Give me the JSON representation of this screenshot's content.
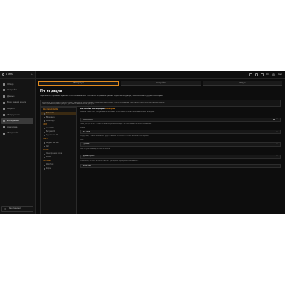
{
  "brand": {
    "name": "A Оrbs"
  },
  "sidebar": {
    "items": [
      {
        "label": "Обзор"
      },
      {
        "label": "Настройки"
      },
      {
        "label": "Данные"
      },
      {
        "label": "Базы знаний агента"
      },
      {
        "label": "Модели"
      },
      {
        "label": "Инструменты"
      },
      {
        "label": "Интеграции"
      },
      {
        "label": "Аналитика"
      },
      {
        "label": "Интерфейс"
      }
    ],
    "footer": {
      "label": "Ваш Кабинет"
    }
  },
  "topbar": {
    "lang": "RU",
    "user": "User"
  },
  "steps": [
    {
      "label": "Интеграции"
    },
    {
      "label": "Настройки"
    },
    {
      "label": "Запуск"
    }
  ],
  "page": {
    "title": "Интеграции",
    "description": "Подключите сторонние сервисы, чтобы ваш агент мог получать и отправлять данные через мессенджеры, CRM-системы и другие платформы.",
    "info": [
      "Выберите интеграцию в списке слева и заполните необходимые параметры подключения. После сохранения агент начнёт работать в выбранном канале.",
      "Некоторые интеграции требуют дополнительных ключей доступа."
    ]
  },
  "integrations": {
    "groups": [
      {
        "title": "Мессенджеры",
        "items": [
          "Телеграм",
          "ВКонтакте",
          "WhatsApp"
        ]
      },
      {
        "title": "CRM",
        "items": [
          "amoCRM",
          "Битрикс24",
          "Сделки по API"
        ]
      },
      {
        "title": "Сайт",
        "items": [
          "Виджет на сайт",
          "API"
        ]
      },
      {
        "title": "Почта",
        "items": [
          "Электронная почта",
          "SMTP"
        ]
      },
      {
        "title": "Прочее",
        "items": [
          "Webhook",
          "Zapier"
        ]
      }
    ],
    "selected": "Телеграм"
  },
  "detail": {
    "title_prefix": "Настройки интеграции",
    "title_accent": "Телеграм",
    "subtitle": "Укажите токен бота, полученный в BotFather, чтобы агент отвечал пользователям в Телеграм.",
    "sections": [
      {
        "label": "Токен",
        "value": "••••••••••••••••",
        "hint": "Токен доступа к боту. Хранится в зашифрованном виде и не отображается после сохранения."
      },
      {
        "label": "Режим",
        "value": "Все чаты",
        "hint": "Определяет, в каких чатах агент будет отвечать: во всех или только в личных сообщениях."
      },
      {
        "label": "Язык",
        "value": "Русский",
        "hint": "Язык по умолчанию для ответов агента."
      },
      {
        "label": "Приветствие",
        "value": "Здравствуйте!",
        "hint": "Сообщение, которое агент отправляет при первом обращении пользователя."
      },
      {
        "label": "Уведомления",
        "value": "Включены",
        "hint": ""
      }
    ]
  }
}
